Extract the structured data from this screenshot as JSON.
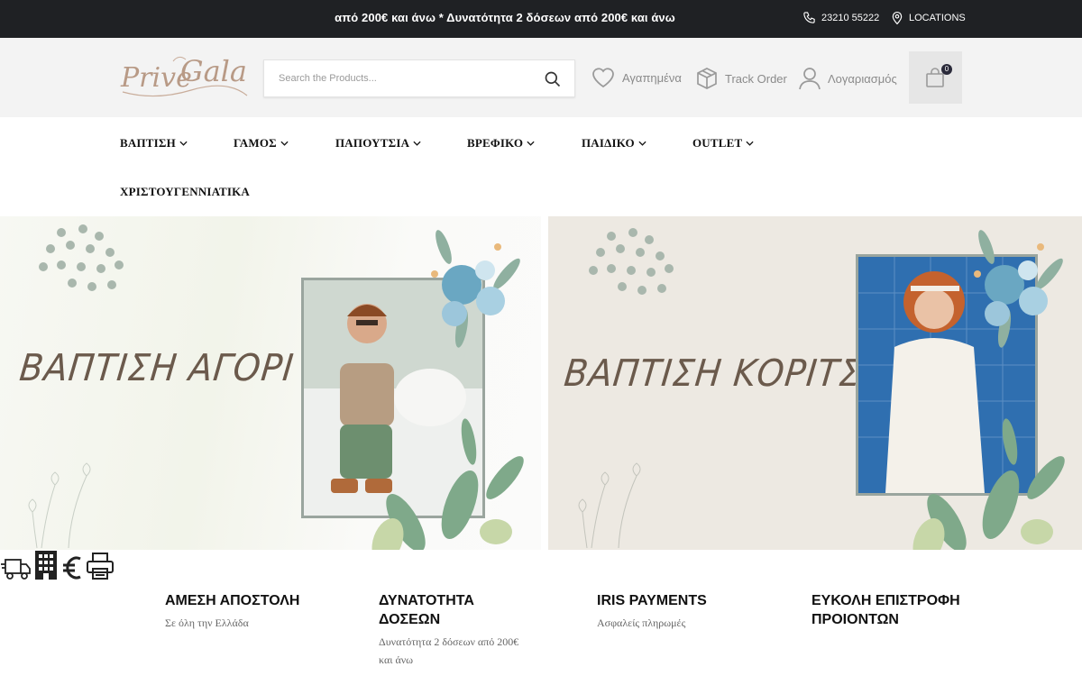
{
  "topbar": {
    "promo": "από 200€ και άνω * Δυνατότητα 2 δόσεων από 200€ και άνω",
    "phone": "23210 55222",
    "locations": "LOCATIONS"
  },
  "header": {
    "logo_text": "Prive Gala",
    "search_placeholder": "Search the Products...",
    "wishlist": "Αγαπημένα",
    "track_order": "Track Order",
    "account": "Λογαριασμός",
    "cart_count": "0"
  },
  "nav": {
    "items": [
      {
        "label": "ΒΑΠΤΙΣΗ",
        "has_dropdown": true
      },
      {
        "label": "ΓΑΜΟΣ",
        "has_dropdown": true
      },
      {
        "label": "ΠΑΠΟΥΤΣΙΑ",
        "has_dropdown": true
      },
      {
        "label": "ΒΡΕΦΙΚΟ",
        "has_dropdown": true
      },
      {
        "label": "ΠΑΙΔΙΚΟ",
        "has_dropdown": true
      },
      {
        "label": "OUTLET",
        "has_dropdown": true
      },
      {
        "label": "ΧΡΙΣΤΟΥΓΕΝΝΙΑΤΙΚΑ",
        "has_dropdown": false
      }
    ]
  },
  "banners": {
    "left_title": "ΒΑΠΤΙΣΗ ΑΓΟΡΙ",
    "right_title": "ΒΑΠΤΙΣΗ ΚΟΡΙΤΣΙ"
  },
  "features": [
    {
      "title": "ΑΜΕΣΗ ΑΠΟΣΤΟΛΗ",
      "subtitle": "Σε όλη την Ελλάδα",
      "icon": "truck-icon"
    },
    {
      "title_line1": "ΔΥΝΑΤΟΤΗΤΑ",
      "title_line2": "ΔΟΣΕΩΝ",
      "subtitle_line1": "Δυνατότητα 2 δόσεων από 200€",
      "subtitle_line2": "και άνω",
      "icon": "building-icon"
    },
    {
      "title": "IRIS PAYMENTS",
      "subtitle": "Ασφαλείς πληρωμές",
      "icon": "euro-icon"
    },
    {
      "title_line1": "ΕΥΚΟΛΗ ΕΠΙΣΤΡΟΦΗ",
      "title_line2": "ΠΡΟΙΟΝΤΩΝ",
      "icon": "printer-icon"
    }
  ],
  "colors": {
    "topbar_bg": "#1f2124",
    "header_bg": "#f3f3f3",
    "banner_title": "#6b5a4c",
    "right_banner_bg": "#ede9e2"
  }
}
